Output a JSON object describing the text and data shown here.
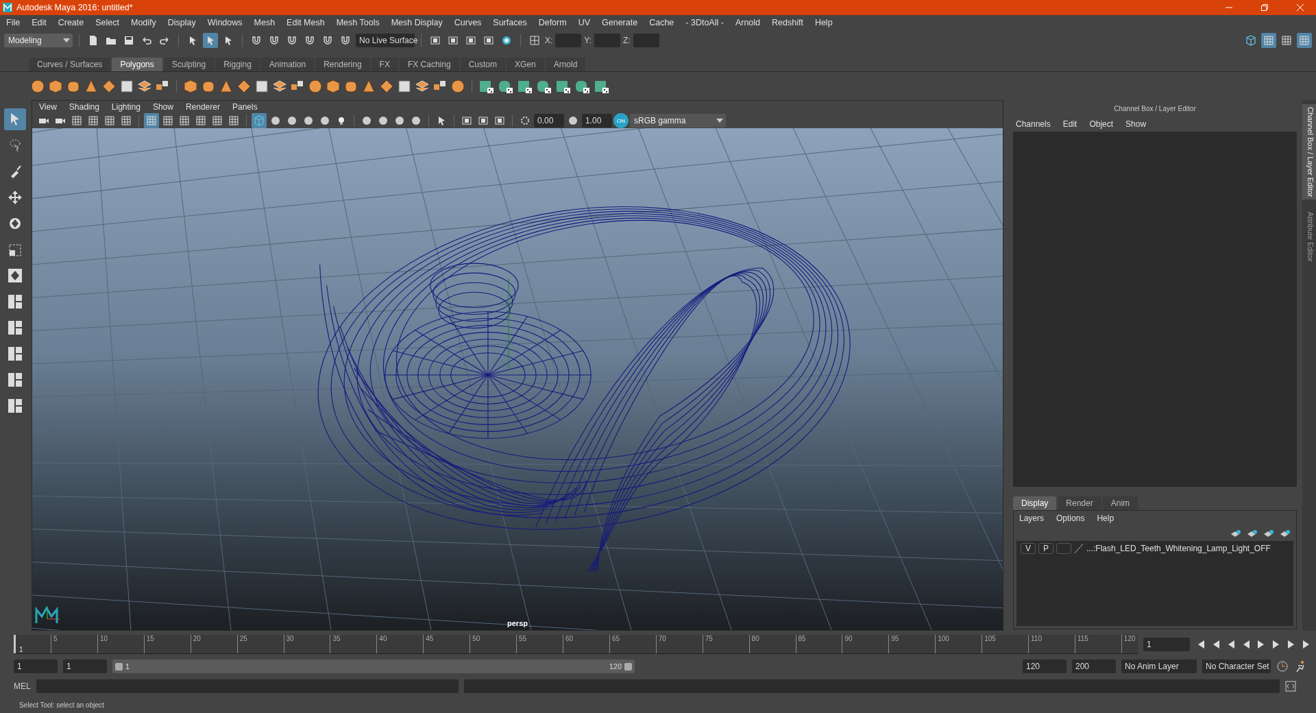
{
  "window": {
    "title": "Autodesk Maya 2016: untitled*"
  },
  "menu": [
    "File",
    "Edit",
    "Create",
    "Select",
    "Modify",
    "Display",
    "Windows",
    "Mesh",
    "Edit Mesh",
    "Mesh Tools",
    "Mesh Display",
    "Curves",
    "Surfaces",
    "Deform",
    "UV",
    "Generate",
    "Cache",
    "- 3DtoAll -",
    "Arnold",
    "Redshift",
    "Help"
  ],
  "toolbar": {
    "mode": "Modeling",
    "live_surface": "No Live Surface",
    "coord_labels": [
      "X:",
      "Y:",
      "Z:"
    ]
  },
  "shelf_tabs": [
    {
      "label": "Curves / Surfaces",
      "selected": false
    },
    {
      "label": "Polygons",
      "selected": true
    },
    {
      "label": "Sculpting",
      "selected": false
    },
    {
      "label": "Rigging",
      "selected": false
    },
    {
      "label": "Animation",
      "selected": false
    },
    {
      "label": "Rendering",
      "selected": false
    },
    {
      "label": "FX",
      "selected": false
    },
    {
      "label": "FX Caching",
      "selected": false
    },
    {
      "label": "Custom",
      "selected": false
    },
    {
      "label": "XGen",
      "selected": false
    },
    {
      "label": "Arnold",
      "selected": false
    }
  ],
  "panel_menu": [
    "View",
    "Shading",
    "Lighting",
    "Show",
    "Renderer",
    "Panels"
  ],
  "viewport_toolbar": {
    "exposure": "0.00",
    "gamma": "1.00",
    "color_space_toggle": "ON",
    "color_space": "sRGB gamma"
  },
  "viewport": {
    "camera": "persp"
  },
  "channel_box": {
    "title": "Channel Box / Layer Editor",
    "menu": [
      "Channels",
      "Edit",
      "Object",
      "Show"
    ]
  },
  "layer_editor": {
    "tabs": [
      {
        "label": "Display",
        "selected": true
      },
      {
        "label": "Render",
        "selected": false
      },
      {
        "label": "Anim",
        "selected": false
      }
    ],
    "menu": [
      "Layers",
      "Options",
      "Help"
    ],
    "layers": [
      {
        "visible": "V",
        "playback": "P",
        "name": "...:Flash_LED_Teeth_Whitening_Lamp_Light_OFF"
      }
    ]
  },
  "side_tabs": [
    {
      "label": "Channel Box / Layer Editor",
      "selected": true
    },
    {
      "label": "Attribute Editor",
      "selected": false
    }
  ],
  "timeline": {
    "level": 0,
    "first": "1",
    "ticks": [
      "5",
      "10",
      "15",
      "20",
      "25",
      "30",
      "35",
      "40",
      "45",
      "50",
      "55",
      "60",
      "65",
      "70",
      "75",
      "80",
      "85",
      "90",
      "95",
      "100",
      "105",
      "110",
      "115",
      "120"
    ],
    "current_frame": "1"
  },
  "range": {
    "level": 1,
    "start": "1",
    "playback_start": "1",
    "slider_start": "1",
    "slider_end": "120",
    "playback_end": "120",
    "end": "200",
    "anim_layer": "No Anim Layer",
    "character_set": "No Character Set"
  },
  "command_line": {
    "language": "MEL"
  },
  "status_bar": "Select Tool: select an object"
}
